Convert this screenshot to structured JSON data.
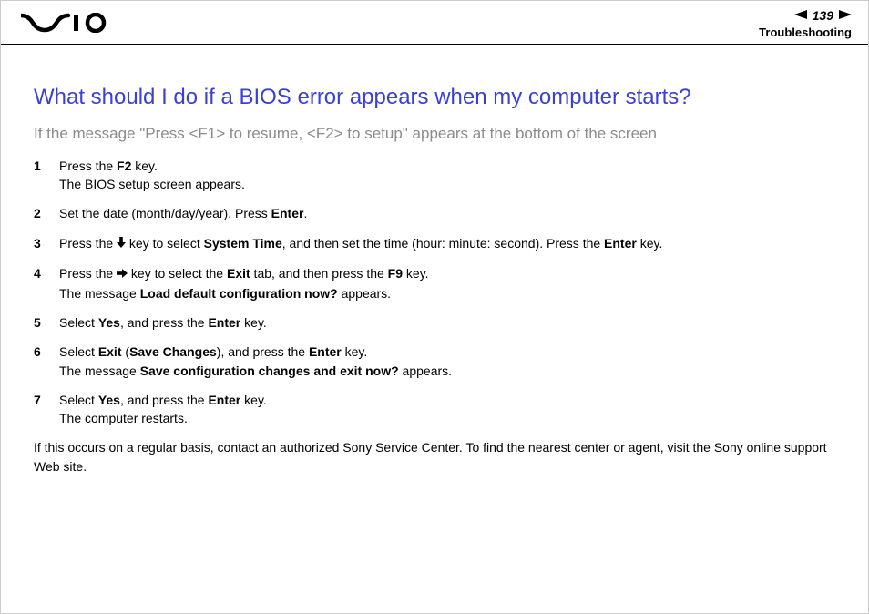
{
  "header": {
    "page_number": "139",
    "section": "Troubleshooting"
  },
  "title": "What should I do if a BIOS error appears when my computer starts?",
  "subtitle": "If the message \"Press <F1> to resume, <F2> to setup\" appears at the bottom of the screen",
  "steps": [
    {
      "num": "1",
      "p1a": "Press the ",
      "p1b": "F2",
      "p1c": " key.",
      "p2": "The BIOS setup screen appears."
    },
    {
      "num": "2",
      "p1a": "Set the date (month/day/year). Press ",
      "p1b": "Enter",
      "p1c": "."
    },
    {
      "num": "3",
      "p1a": "Press the ",
      "arrow": "down",
      "p1b": " key to select ",
      "p1c": "System Time",
      "p1d": ", and then set the time (hour: minute: second). Press the ",
      "p1e": "Enter",
      "p1f": " key."
    },
    {
      "num": "4",
      "p1a": "Press the ",
      "arrow": "right",
      "p1b": " key to select the ",
      "p1c": "Exit",
      "p1d": " tab, and then press the ",
      "p1e": "F9",
      "p1f": " key.",
      "p2a": "The message ",
      "p2b": "Load default configuration now?",
      "p2c": " appears."
    },
    {
      "num": "5",
      "p1a": "Select ",
      "p1b": "Yes",
      "p1c": ", and press the ",
      "p1d": "Enter",
      "p1e": " key."
    },
    {
      "num": "6",
      "p1a": "Select ",
      "p1b": "Exit",
      "p1c": " (",
      "p1d": "Save Changes",
      "p1e": "), and press the ",
      "p1f": "Enter",
      "p1g": " key.",
      "p2a": "The message ",
      "p2b": "Save configuration changes and exit now?",
      "p2c": " appears."
    },
    {
      "num": "7",
      "p1a": "Select ",
      "p1b": "Yes",
      "p1c": ", and press the ",
      "p1d": "Enter",
      "p1e": " key.",
      "p2": "The computer restarts."
    }
  ],
  "closing": "If this occurs on a regular basis, contact an authorized Sony Service Center. To find the nearest center or agent, visit the Sony online support Web site."
}
